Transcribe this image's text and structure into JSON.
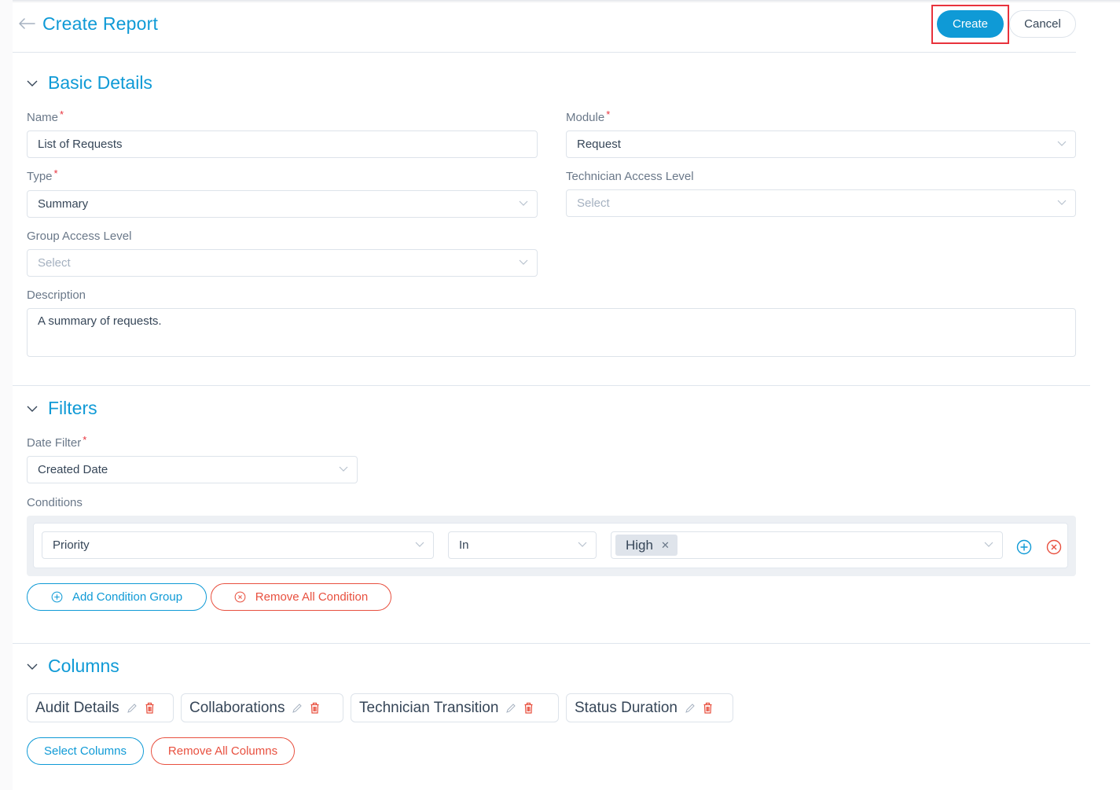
{
  "header": {
    "title": "Create Report",
    "create_label": "Create",
    "cancel_label": "Cancel"
  },
  "colors": {
    "accent": "#0f9ad6",
    "danger": "#e8503f",
    "highlight": "#e8323c"
  },
  "basic_details": {
    "title": "Basic Details",
    "name": {
      "label": "Name",
      "required": "*",
      "value": "List of Requests"
    },
    "module": {
      "label": "Module",
      "required": "*",
      "value": "Request"
    },
    "type": {
      "label": "Type",
      "required": "*",
      "value": "Summary"
    },
    "technician_access_level": {
      "label": "Technician Access Level",
      "placeholder": "Select"
    },
    "group_access_level": {
      "label": "Group Access Level",
      "placeholder": "Select"
    },
    "description": {
      "label": "Description",
      "value": "A summary of requests."
    }
  },
  "filters": {
    "title": "Filters",
    "date_filter": {
      "label": "Date Filter",
      "required": "*",
      "value": "Created Date"
    },
    "conditions_label": "Conditions",
    "condition": {
      "field": "Priority",
      "operator": "In",
      "values": [
        "High"
      ]
    },
    "add_group_label": "Add Condition Group",
    "remove_all_label": "Remove All Condition"
  },
  "columns": {
    "title": "Columns",
    "items": [
      {
        "label": "Audit Details"
      },
      {
        "label": "Collaborations"
      },
      {
        "label": "Technician Transition"
      },
      {
        "label": "Status Duration"
      }
    ],
    "select_label": "Select Columns",
    "remove_all_label": "Remove All Columns"
  }
}
